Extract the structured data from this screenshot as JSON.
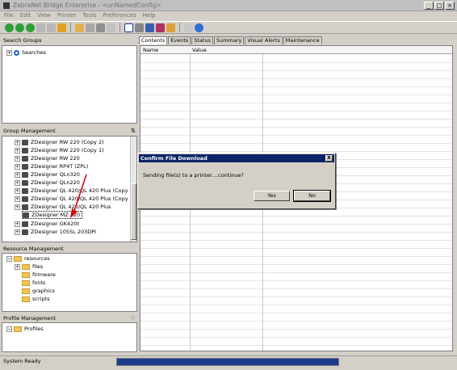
{
  "window": {
    "title": "ZebraNet Bridge Enterprise - <unNamedConfig>"
  },
  "menu": [
    "File",
    "Edit",
    "View",
    "Printer",
    "Tools",
    "Preferences",
    "Help"
  ],
  "search_groups": {
    "header": "Search Groups",
    "items": [
      {
        "label": "Searches"
      }
    ]
  },
  "group_management": {
    "header": "Group Management",
    "items": [
      "ZDesigner RW 220 (Copy 2)",
      "ZDesigner RW 220 (Copy 1)",
      "ZDesigner RW 220",
      "ZDesigner RP4T (ZPL)",
      "ZDesigner QLn320",
      "ZDesigner QLn220",
      "ZDesigner QL 420/QL 420 Plus (Copy 2)",
      "ZDesigner QL 420/QL 420 Plus (Copy 1)",
      "ZDesigner QL 420/QL 420 Plus",
      "ZDesigner MZ 320",
      "ZDesigner GK420t",
      "ZDesigner 105SL 203DPI"
    ]
  },
  "resource_management": {
    "header": "Resource Management",
    "root": "resources",
    "children": [
      "files",
      "firmware",
      "fonts",
      "graphics",
      "scripts"
    ]
  },
  "profile_management": {
    "header": "Profile Management",
    "items": [
      "Profiles"
    ]
  },
  "tabs": [
    "Contents",
    "Events",
    "Status",
    "Summary",
    "Visual Alerts",
    "Maintenance"
  ],
  "grid": {
    "columns": [
      "Name",
      "Value"
    ]
  },
  "dialog": {
    "title": "Confirm File Download",
    "message": "Sending file(s) to a printer....continue?",
    "yes": "Yes",
    "no": "No",
    "close": "X"
  },
  "status": {
    "text": "System Ready"
  }
}
